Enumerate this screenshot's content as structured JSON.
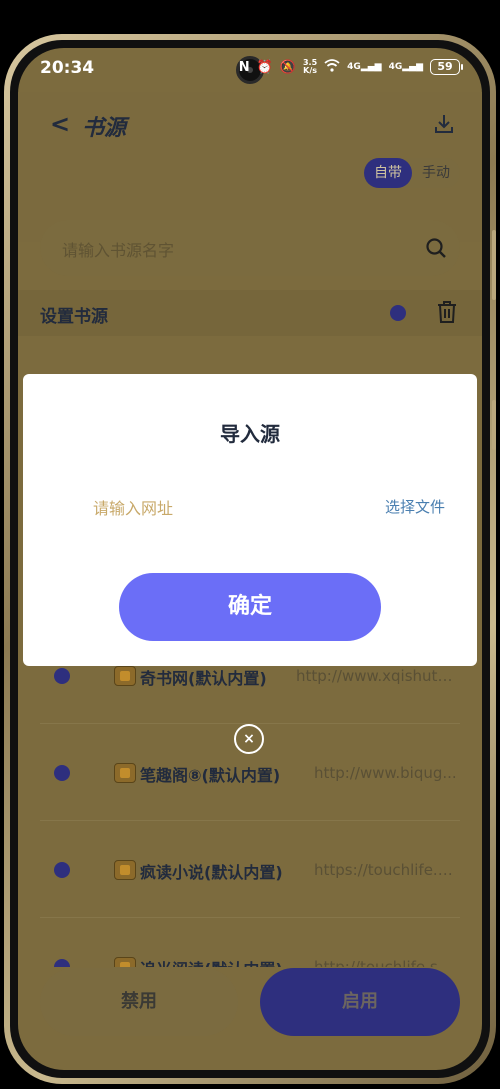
{
  "status_bar": {
    "time": "20:34",
    "net_speed_top": "3.5",
    "net_speed_bottom": "K/s",
    "sig1": "4G",
    "sig2": "4G",
    "battery": "59"
  },
  "header": {
    "title": "书源",
    "segment": {
      "option_builtin": "自带",
      "option_manual": "手动",
      "selected": "自带"
    }
  },
  "search": {
    "placeholder": "请输入书源名字"
  },
  "set_source": {
    "label": "设置书源"
  },
  "sources": [
    {
      "name": "奇书网(默认内置)",
      "url": "http://www.xqishuta...."
    },
    {
      "name": "笔趣阁⑧(默认内置)",
      "url": "http://www.biqug..."
    },
    {
      "name": "疯读小说(默认内置)",
      "url": "https://touchlife.c..."
    },
    {
      "name": "追光阅读(默认内置)",
      "url": "http://touchlife.sc..."
    }
  ],
  "actions": {
    "disable": "禁用",
    "enable": "启用"
  },
  "modal": {
    "title": "导入源",
    "url_placeholder": "请输入网址",
    "choose_file": "选择文件",
    "confirm": "确定",
    "close": "×"
  },
  "colors": {
    "accent": "#6b6ef7",
    "selected_segment": "#2e2f7e",
    "link": "#4a7fb0",
    "scrim_background": "#7c6b3e"
  }
}
